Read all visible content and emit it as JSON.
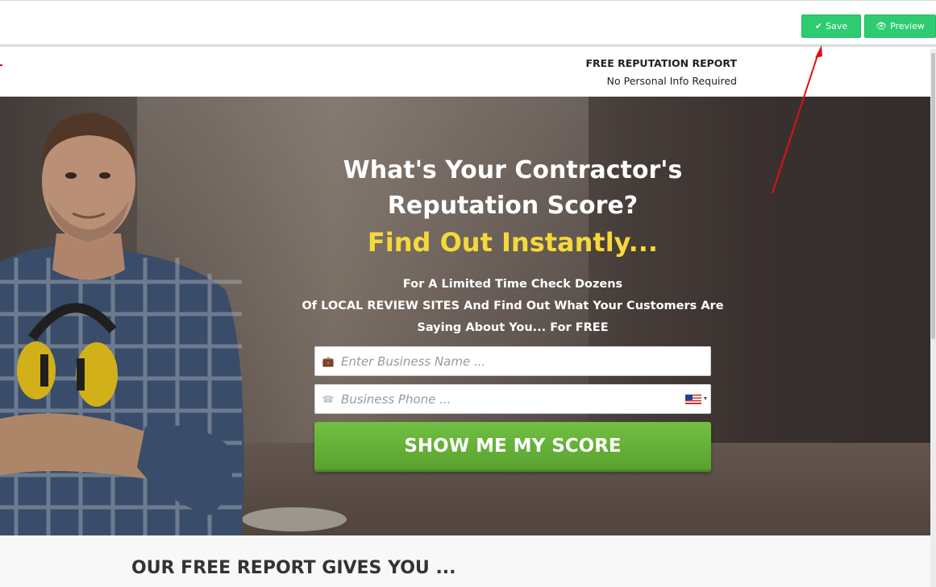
{
  "editor_toolbar": {
    "save_label": "Save",
    "preview_label": "Preview",
    "save_icon": "check-icon",
    "preview_icon": "eye-icon"
  },
  "landing_header": {
    "title": "FREE REPUTATION REPORT",
    "subtitle": "No Personal Info Required"
  },
  "hero": {
    "headline_line1": "What's Your Contractor's",
    "headline_line2": "Reputation Score?",
    "headline_highlight": "Find Out Instantly...",
    "subtext_line1": "For A Limited Time Check Dozens",
    "subtext_line2": "Of LOCAL REVIEW SITES And Find Out What Your Customers Are",
    "subtext_line3": "Saying About You... For FREE",
    "business_name_placeholder": "Enter Business Name ...",
    "business_phone_placeholder": "Business Phone ...",
    "business_name_icon": "briefcase-icon",
    "business_phone_icon": "phone-icon",
    "country_flag": "us-flag-icon",
    "cta_label": "SHOW ME MY SCORE"
  },
  "section": {
    "title": "OUR FREE REPORT GIVES YOU ..."
  },
  "colors": {
    "button_green": "#2ecc71",
    "cta_green": "#5aa230",
    "highlight_yellow": "#f5d93a",
    "annotation_arrow": "#e01010"
  }
}
